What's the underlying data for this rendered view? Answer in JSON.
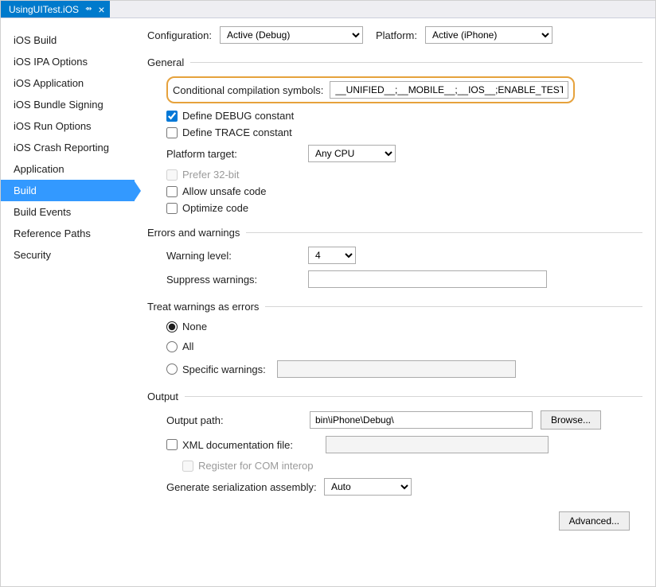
{
  "tab": {
    "title": "UsingUITest.iOS",
    "pin": "⇴",
    "close": "×"
  },
  "sidebar": {
    "items": [
      "iOS Build",
      "iOS IPA Options",
      "iOS Application",
      "iOS Bundle Signing",
      "iOS Run Options",
      "iOS Crash Reporting",
      "Application",
      "Build",
      "Build Events",
      "Reference Paths",
      "Security"
    ],
    "active_index": 7
  },
  "top": {
    "config_label": "Configuration:",
    "config_value": "Active (Debug)",
    "platform_label": "Platform:",
    "platform_value": "Active (iPhone)"
  },
  "general": {
    "title": "General",
    "cond_label": "Conditional compilation symbols:",
    "cond_value": "__UNIFIED__;__MOBILE__;__IOS__;ENABLE_TEST_CLOUD;",
    "define_debug": "Define DEBUG constant",
    "define_trace": "Define TRACE constant",
    "platform_target_label": "Platform target:",
    "platform_target_value": "Any CPU",
    "prefer_32bit": "Prefer 32-bit",
    "allow_unsafe": "Allow unsafe code",
    "optimize": "Optimize code"
  },
  "errors": {
    "title": "Errors and warnings",
    "warning_level_label": "Warning level:",
    "warning_level_value": "4",
    "suppress_label": "Suppress warnings:",
    "suppress_value": ""
  },
  "twae": {
    "title": "Treat warnings as errors",
    "none": "None",
    "all": "All",
    "specific": "Specific warnings:",
    "specific_value": ""
  },
  "output": {
    "title": "Output",
    "output_path_label": "Output path:",
    "output_path_value": "bin\\iPhone\\Debug\\",
    "browse": "Browse...",
    "xml_doc": "XML documentation file:",
    "xml_doc_value": "",
    "register_com": "Register for COM interop",
    "gen_serial_label": "Generate serialization assembly:",
    "gen_serial_value": "Auto"
  },
  "advanced": "Advanced..."
}
